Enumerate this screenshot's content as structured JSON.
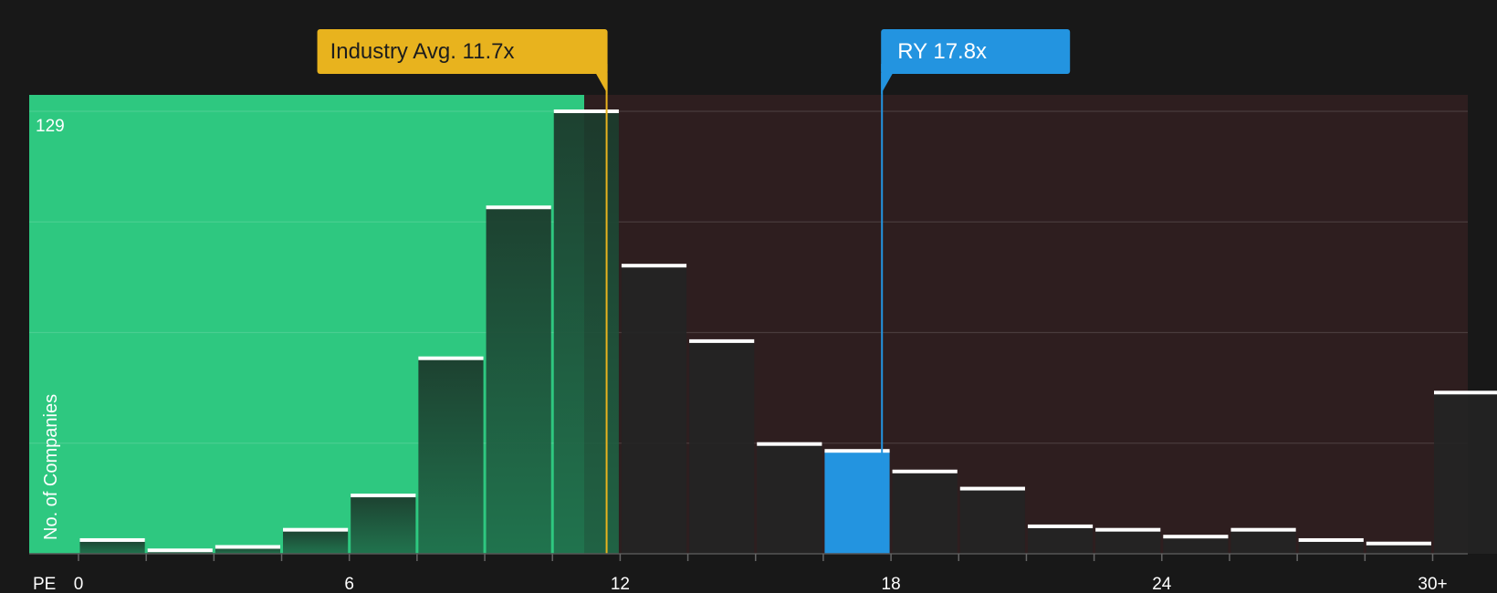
{
  "chart_data": {
    "type": "bar",
    "x_axis_label": "PE",
    "y_axis_label": "No. of Companies",
    "y_max_label": "129",
    "ylim": [
      0,
      129
    ],
    "x_ticks": [
      {
        "value": 0,
        "label": "0"
      },
      {
        "value": 6,
        "label": "6"
      },
      {
        "value": 12,
        "label": "12"
      },
      {
        "value": 18,
        "label": "18"
      },
      {
        "value": 24,
        "label": "24"
      },
      {
        "value": 30,
        "label": "30+"
      }
    ],
    "bins": [
      {
        "start": 0.0,
        "end": 1.5,
        "value": 4
      },
      {
        "start": 1.5,
        "end": 3.0,
        "value": 1
      },
      {
        "start": 3.0,
        "end": 4.5,
        "value": 2
      },
      {
        "start": 4.5,
        "end": 6.0,
        "value": 7
      },
      {
        "start": 6.0,
        "end": 7.5,
        "value": 17
      },
      {
        "start": 7.5,
        "end": 9.0,
        "value": 57
      },
      {
        "start": 9.0,
        "end": 10.5,
        "value": 101
      },
      {
        "start": 10.5,
        "end": 12.0,
        "value": 129
      },
      {
        "start": 12.0,
        "end": 13.5,
        "value": 84
      },
      {
        "start": 13.5,
        "end": 15.0,
        "value": 62
      },
      {
        "start": 15.0,
        "end": 16.5,
        "value": 32
      },
      {
        "start": 16.5,
        "end": 18.0,
        "value": 30,
        "highlight": true
      },
      {
        "start": 18.0,
        "end": 19.5,
        "value": 24
      },
      {
        "start": 19.5,
        "end": 21.0,
        "value": 19
      },
      {
        "start": 21.0,
        "end": 22.5,
        "value": 8
      },
      {
        "start": 22.5,
        "end": 24.0,
        "value": 7
      },
      {
        "start": 24.0,
        "end": 25.5,
        "value": 5
      },
      {
        "start": 25.5,
        "end": 27.0,
        "value": 7
      },
      {
        "start": 27.0,
        "end": 28.5,
        "value": 4
      },
      {
        "start": 28.5,
        "end": 30.0,
        "value": 3
      },
      {
        "start": 30.0,
        "end": 31.5,
        "value": 47
      }
    ],
    "industry_avg": {
      "value": 11.7,
      "label": "Industry Avg. 11.7x",
      "color": "#E8B31E"
    },
    "company": {
      "value": 17.8,
      "label": "RY 17.8x",
      "color": "#2394E0"
    },
    "colors": {
      "background": "#181818",
      "undervalued_zone": "#2EC880",
      "overvalued_zone": "#2E1E1F",
      "bar": "#242424",
      "bar_top": "#FFFFFF",
      "highlight_bar": "#2394E0",
      "text": "#FFFFFF"
    }
  }
}
